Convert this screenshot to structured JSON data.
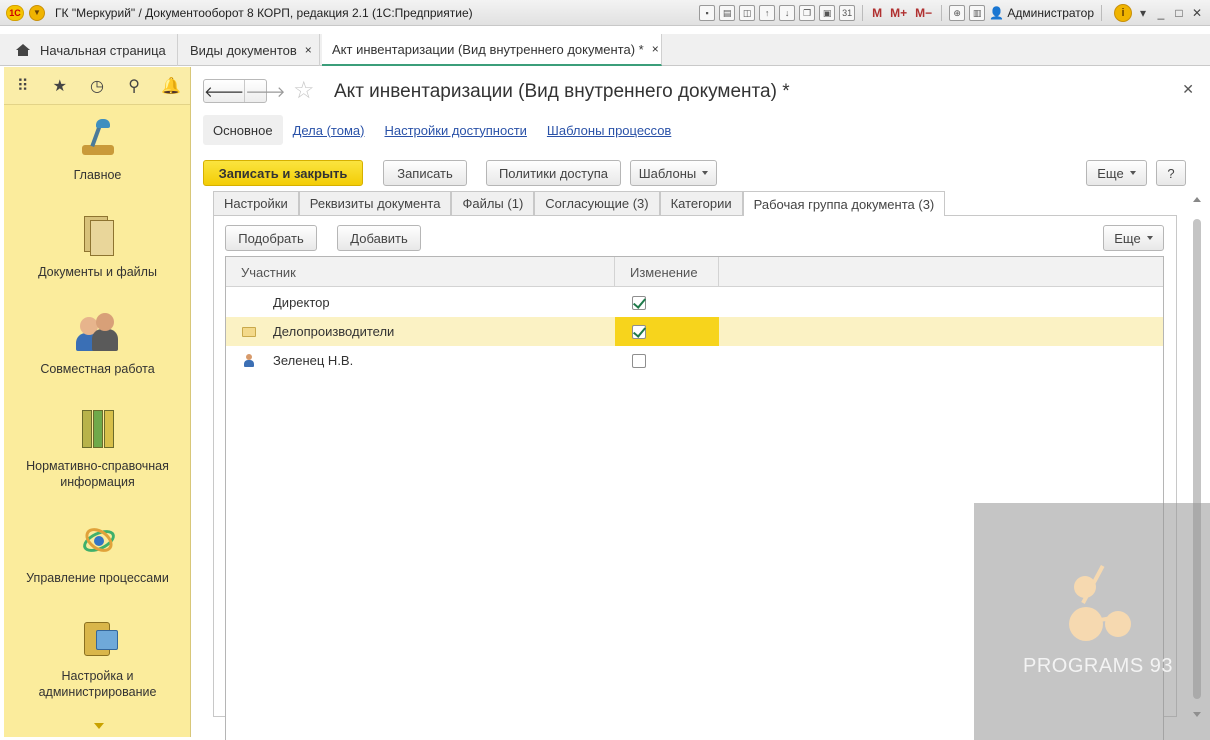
{
  "app": {
    "title": "ГК \"Меркурий\" / Документооборот 8 КОРП, редакция 2.1  (1С:Предприятие)",
    "logo": "1С",
    "user": "Администратор",
    "toolbar_icons": [
      "save-icon",
      "print-icon",
      "preview-icon",
      "upload-icon",
      "download-icon",
      "copy-icon",
      "paste-icon",
      "calendar-icon"
    ],
    "memory_buttons": [
      "M",
      "M+",
      "M−"
    ]
  },
  "open_tabs": [
    {
      "label": "Начальная страница",
      "icon": "home-icon"
    },
    {
      "label": "Виды документов",
      "close": "×"
    },
    {
      "label": "Акт инвентаризации (Вид внутреннего документа) *",
      "close": "×"
    }
  ],
  "sidebar": {
    "tools": [
      "apps-grid-icon",
      "favorites-star-icon",
      "history-icon",
      "search-icon",
      "notifications-bell-icon"
    ],
    "items": [
      {
        "label": "Главное",
        "icon": "desk-lamp-icon"
      },
      {
        "label": "Документы и файлы",
        "icon": "documents-icon"
      },
      {
        "label": "Совместная работа",
        "icon": "people-icon"
      },
      {
        "label": "Нормативно-справочная информация",
        "icon": "binders-icon"
      },
      {
        "label": "Управление процессами",
        "icon": "process-icon"
      },
      {
        "label": "Настройка и администрирование",
        "icon": "admin-icon"
      }
    ]
  },
  "form": {
    "title": "Акт инвентаризации (Вид внутреннего документа) *",
    "sections": [
      "Основное",
      "Дела (тома)",
      "Настройки доступности",
      "Шаблоны процессов"
    ],
    "buttons": {
      "save_close": "Записать и закрыть",
      "save": "Записать",
      "access_policies": "Политики доступа",
      "templates": "Шаблоны",
      "more": "Еще",
      "help": "?"
    },
    "tabs": [
      "Настройки",
      "Реквизиты документа",
      "Файлы (1)",
      "Согласующие (3)",
      "Категории",
      "Рабочая группа документа (3)"
    ],
    "grid_buttons": {
      "pick": "Подобрать",
      "add": "Добавить",
      "more": "Еще"
    },
    "grid": {
      "columns": [
        "Участник",
        "Изменение"
      ],
      "rows": [
        {
          "name": "Директор",
          "icon": "",
          "change": true,
          "selected": false
        },
        {
          "name": "Делопроизводители",
          "icon": "folder-icon",
          "change": true,
          "selected": true
        },
        {
          "name": "Зеленец Н.В.",
          "icon": "user-icon",
          "change": false,
          "selected": false
        }
      ]
    }
  },
  "watermark": {
    "text": "PROGRAMS 93"
  }
}
